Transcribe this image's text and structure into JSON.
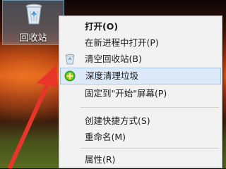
{
  "desktop": {
    "recycle_bin_label": "回收站"
  },
  "menu": {
    "items": [
      {
        "label": "打开(O)",
        "icon": "",
        "bold": true,
        "highlighted": false
      },
      {
        "label": "在新进程中打开(P)",
        "icon": "",
        "bold": false,
        "highlighted": false
      },
      {
        "label": "清空回收站(B)",
        "icon": "recycle-bin-icon",
        "bold": false,
        "highlighted": false
      },
      {
        "label": "深度清理垃圾",
        "icon": "cleaner-icon",
        "bold": false,
        "highlighted": true
      },
      {
        "label": "固定到\"开始\"屏幕(P)",
        "icon": "",
        "bold": false,
        "highlighted": false
      },
      {
        "label": "创建快捷方式(S)",
        "icon": "",
        "bold": false,
        "highlighted": false
      },
      {
        "label": "重命名(M)",
        "icon": "",
        "bold": false,
        "highlighted": false
      },
      {
        "label": "属性(R)",
        "icon": "",
        "bold": false,
        "highlighted": false
      }
    ]
  },
  "colors": {
    "highlight_bg": "#dbe9f8",
    "arrow": "#e8352a"
  }
}
